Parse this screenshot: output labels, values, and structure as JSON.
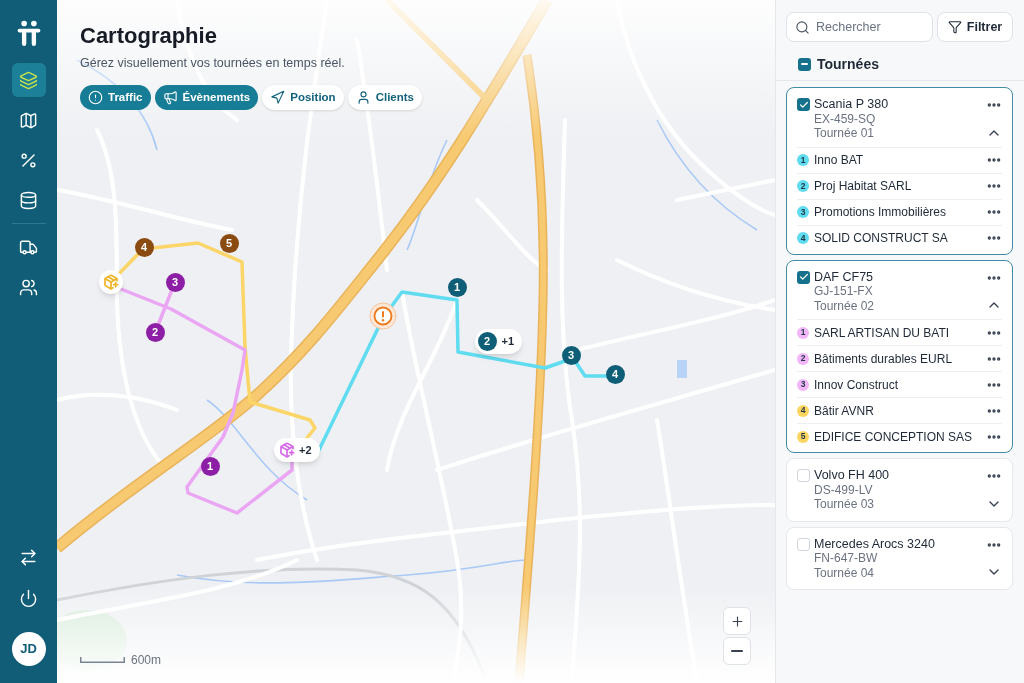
{
  "sidebar": {
    "nav_items": [
      {
        "selected": true
      },
      {
        "selected": false
      },
      {
        "selected": false
      },
      {
        "selected": false
      },
      {
        "selected": false
      },
      {
        "selected": false
      }
    ],
    "avatar": {
      "initials": "JD"
    }
  },
  "header": {
    "title": "Cartographie",
    "subtitle": "Gérez visuellement vos tournées en temps réel."
  },
  "filters": [
    {
      "label": "Traffic",
      "selected": true
    },
    {
      "label": "Évènements",
      "selected": true
    },
    {
      "label": "Position",
      "selected": false
    },
    {
      "label": "Clients",
      "selected": false
    }
  ],
  "map": {
    "routes": [
      {
        "color": "#fbd567",
        "stops": [
          {
            "label": "4",
            "color": "#8a4a10"
          },
          {
            "label": "5",
            "color": "#8a4a10"
          }
        ]
      },
      {
        "color": "#eaa6f3",
        "stops": [
          {
            "label": "1",
            "color": "#8c1fa5"
          },
          {
            "label": "2",
            "color": "#8c1fa5"
          },
          {
            "label": "3",
            "color": "#8c1fa5"
          }
        ]
      },
      {
        "color": "#5fdcf0",
        "stops": [
          {
            "label": "1",
            "color": "#0f5e78"
          },
          {
            "label": "2",
            "color": "#0f5e78",
            "more": "+1"
          },
          {
            "label": "3",
            "color": "#0f5e78"
          },
          {
            "label": "4",
            "color": "#0f5e78"
          }
        ]
      }
    ],
    "depots": [
      {
        "color": "#f0b429"
      },
      {
        "color": "#d66be8",
        "more": "+2"
      }
    ],
    "scale": "600m"
  },
  "panel": {
    "search": {
      "placeholder": "Rechercher"
    },
    "filter_button": "Filtrer",
    "section": {
      "title": "Tournées",
      "indeterminate": true
    },
    "tours": [
      {
        "vehicle": "Scania P 380",
        "plate": "EX-459-SQ",
        "tour": "Tournée 01",
        "checked": true,
        "expanded": true,
        "stops": [
          {
            "number": "1",
            "name": "Inno BAT",
            "color": "#5fdcf0"
          },
          {
            "number": "2",
            "name": "Proj Habitat SARL",
            "color": "#5fdcf0"
          },
          {
            "number": "3",
            "name": "Promotions Immobilières",
            "color": "#5fdcf0"
          },
          {
            "number": "4",
            "name": "SOLID CONSTRUCT SA",
            "color": "#5fdcf0"
          }
        ]
      },
      {
        "vehicle": "DAF CF75",
        "plate": "GJ-151-FX",
        "tour": "Tournée 02",
        "checked": true,
        "expanded": true,
        "stops": [
          {
            "number": "1",
            "name": "SARL ARTISAN DU BATI",
            "color": "#f2b6f8"
          },
          {
            "number": "2",
            "name": "Bâtiments durables EURL",
            "color": "#f2b6f8"
          },
          {
            "number": "3",
            "name": "Innov Construct",
            "color": "#f2b6f8"
          },
          {
            "number": "4",
            "name": "Bâtir AVNR",
            "color": "#fcd660"
          },
          {
            "number": "5",
            "name": "EDIFICE CONCEPTION SAS",
            "color": "#fcd660"
          }
        ]
      },
      {
        "vehicle": "Volvo FH 400",
        "plate": "DS-499-LV",
        "tour": "Tournée 03",
        "checked": false,
        "expanded": false
      },
      {
        "vehicle": "Mercedes Arocs 3240",
        "plate": "FN-647-BW",
        "tour": "Tournée 04",
        "checked": false,
        "expanded": false
      }
    ]
  }
}
